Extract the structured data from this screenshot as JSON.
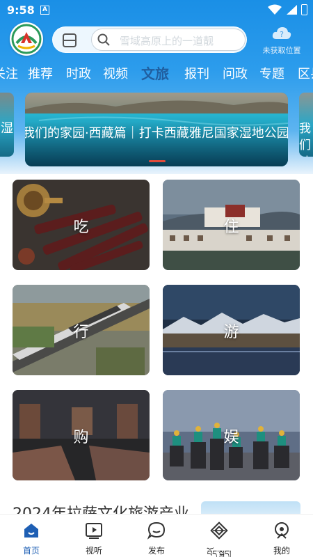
{
  "status_bar": {
    "time": "9:58",
    "notification_letter": "A"
  },
  "header": {
    "search_placeholder": "雪域高原上的一道靓",
    "location_text": "未获取位置",
    "location_glyph": "?"
  },
  "tabs": [
    {
      "label": "关注"
    },
    {
      "label": "推荐"
    },
    {
      "label": "时政"
    },
    {
      "label": "视频"
    },
    {
      "label": "文旅",
      "active": true
    },
    {
      "label": "报刊"
    },
    {
      "label": "问政"
    },
    {
      "label": "专题"
    },
    {
      "label": "区县"
    }
  ],
  "banner": {
    "title": "我们的家园·西藏篇｜打卡西藏雅尼国家湿地公园",
    "left_peek_text": "湿",
    "right_peek_text": "我们地公"
  },
  "categories": [
    {
      "label": "吃",
      "icon": "food-photo"
    },
    {
      "label": "住",
      "icon": "palace-photo"
    },
    {
      "label": "行",
      "icon": "train-photo"
    },
    {
      "label": "游",
      "icon": "mountain-lake-photo"
    },
    {
      "label": "购",
      "icon": "carpet-shop-photo"
    },
    {
      "label": "娱",
      "icon": "horse-riders-photo"
    }
  ],
  "article": {
    "title": "2024年拉萨文化旅游产业"
  },
  "bottom_nav": [
    {
      "label": "首页",
      "icon": "home-icon",
      "active": true
    },
    {
      "label": "视听",
      "icon": "video-icon"
    },
    {
      "label": "发布",
      "icon": "chat-icon"
    },
    {
      "label": "བོད་སྐད།",
      "icon": "endless-knot-icon"
    },
    {
      "label": "我的",
      "icon": "profile-icon"
    }
  ],
  "colors": {
    "brand_blue": "#1a8fe6",
    "active_tab": "#1d4f8c",
    "nav_active": "#1e5fb4"
  }
}
